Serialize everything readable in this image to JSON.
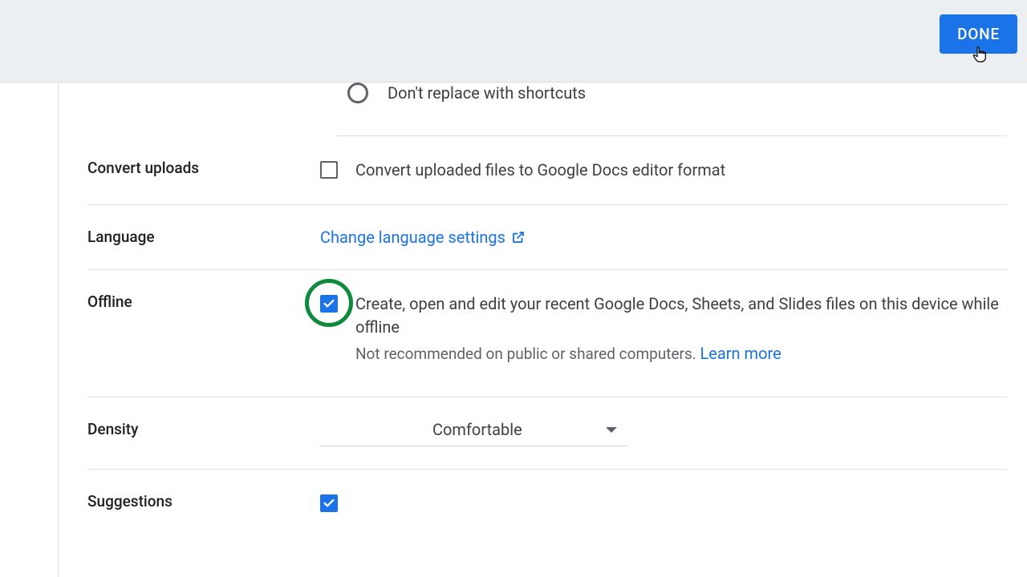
{
  "header": {
    "done_button": "DONE"
  },
  "shortcuts": {
    "radio_label": "Don't replace with shortcuts"
  },
  "convert_uploads": {
    "label": "Convert uploads",
    "checkbox_label": "Convert uploaded files to Google Docs editor format"
  },
  "language": {
    "label": "Language",
    "link_text": "Change language settings"
  },
  "offline": {
    "label": "Offline",
    "checkbox_label": "Create, open and edit your recent Google Docs, Sheets, and Slides files on this device while offline",
    "hint": "Not recommended on public or shared computers. ",
    "learn_more": "Learn more"
  },
  "density": {
    "label": "Density",
    "value": "Comfortable"
  },
  "suggestions": {
    "label": "Suggestions"
  }
}
